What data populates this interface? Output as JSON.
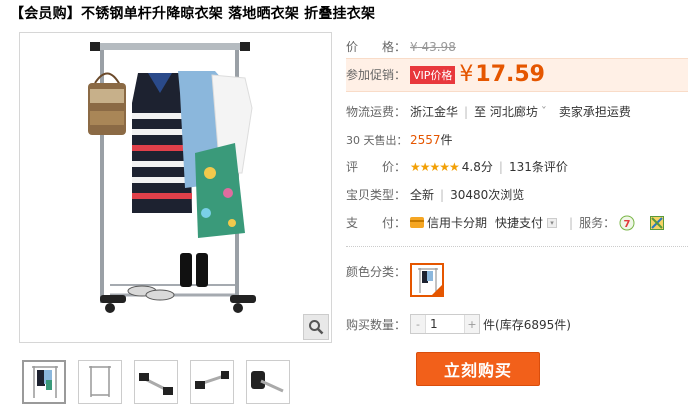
{
  "title": "【会员购】不锈钢单杆升降晾衣架 落地晒衣架 折叠挂衣架",
  "price": {
    "label": "价　　格：",
    "currency": "¥",
    "original": "43.98"
  },
  "promo": {
    "label": "参加促销：",
    "badge": "VIP价格",
    "currency": "¥",
    "value": "17.59"
  },
  "shipping": {
    "label": "物流运费：",
    "from": "浙江金华",
    "to_prefix": "至",
    "to": "河北廊坊",
    "dropdown": "ˇ",
    "fee": "卖家承担运费"
  },
  "sales": {
    "label": "30 天售出：",
    "count": "2557",
    "unit": "件"
  },
  "rating": {
    "label": "评　　价：",
    "stars": "★★★★★",
    "score": "4.8分",
    "reviews": "131条评价"
  },
  "type": {
    "label": "宝贝类型：",
    "condition": "全新",
    "views": "30480次浏览"
  },
  "payment": {
    "label": "支　　付：",
    "credit": "信用卡分期",
    "quick": "快捷支付",
    "service_label": "服务：",
    "service_7_glyph": "7"
  },
  "color": {
    "label": "颜色分类："
  },
  "quantity": {
    "label": "购买数量：",
    "value": "1",
    "minus": "-",
    "plus": "+",
    "unit": "件",
    "stock": "(库存6895件)"
  },
  "buy_button": "立刻购买",
  "colors": {
    "accent": "#e55600",
    "button": "#f2601a",
    "link": "#3366cc"
  }
}
